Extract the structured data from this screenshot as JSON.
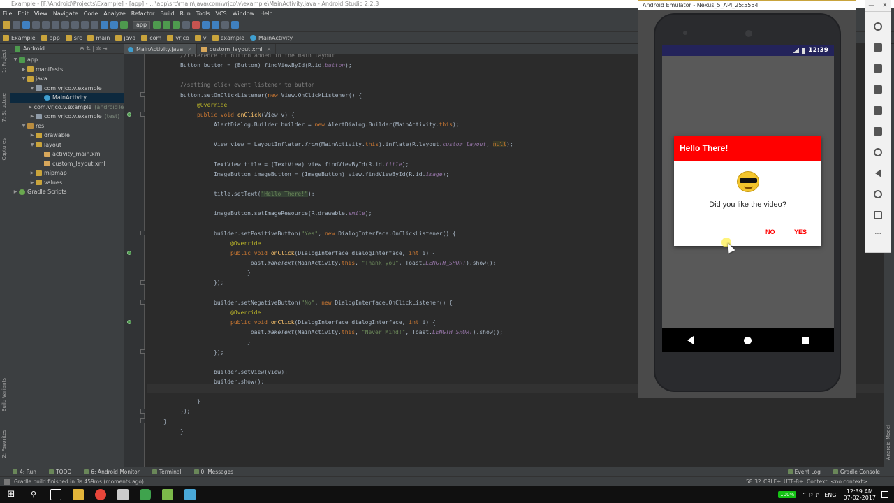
{
  "window_title": "Example - [F:\\Android\\Projects\\Example] - [app] - ...\\app\\src\\main\\java\\com\\vrjco\\v\\example\\MainActivity.java - Android Studio 2.2.3",
  "menu": [
    "File",
    "Edit",
    "View",
    "Navigate",
    "Code",
    "Analyze",
    "Refactor",
    "Build",
    "Run",
    "Tools",
    "VCS",
    "Window",
    "Help"
  ],
  "toolbar": {
    "run_config": "app"
  },
  "breadcrumbs": [
    "Example",
    "app",
    "src",
    "main",
    "java",
    "com",
    "vrjco",
    "v",
    "example",
    "MainActivity"
  ],
  "project_panel": {
    "view_mode": "Android",
    "tree": [
      {
        "label": "app",
        "sub": "",
        "indent": 0,
        "icon": "app",
        "arrow": "▼",
        "sel": false
      },
      {
        "label": "manifests",
        "sub": "",
        "indent": 1,
        "icon": "fold",
        "arrow": "▶",
        "sel": false
      },
      {
        "label": "java",
        "sub": "",
        "indent": 1,
        "icon": "fold",
        "arrow": "▼",
        "sel": false
      },
      {
        "label": "com.vrjco.v.example",
        "sub": "",
        "indent": 2,
        "icon": "pkg",
        "arrow": "▼",
        "sel": false
      },
      {
        "label": "MainActivity",
        "sub": "",
        "indent": 3,
        "icon": "cls",
        "arrow": "",
        "sel": true
      },
      {
        "label": "com.vrjco.v.example",
        "sub": "(androidTest)",
        "indent": 2,
        "icon": "pkg",
        "arrow": "▶",
        "sel": false
      },
      {
        "label": "com.vrjco.v.example",
        "sub": "(test)",
        "indent": 2,
        "icon": "pkg",
        "arrow": "▶",
        "sel": false
      },
      {
        "label": "res",
        "sub": "",
        "indent": 1,
        "icon": "res",
        "arrow": "▼",
        "sel": false
      },
      {
        "label": "drawable",
        "sub": "",
        "indent": 2,
        "icon": "fold",
        "arrow": "▶",
        "sel": false
      },
      {
        "label": "layout",
        "sub": "",
        "indent": 2,
        "icon": "fold",
        "arrow": "▼",
        "sel": false
      },
      {
        "label": "activity_main.xml",
        "sub": "",
        "indent": 3,
        "icon": "xml",
        "arrow": "",
        "sel": false
      },
      {
        "label": "custom_layout.xml",
        "sub": "",
        "indent": 3,
        "icon": "xml",
        "arrow": "",
        "sel": false
      },
      {
        "label": "mipmap",
        "sub": "",
        "indent": 2,
        "icon": "fold",
        "arrow": "▶",
        "sel": false
      },
      {
        "label": "values",
        "sub": "",
        "indent": 2,
        "icon": "fold",
        "arrow": "▶",
        "sel": false
      },
      {
        "label": "Gradle Scripts",
        "sub": "",
        "indent": 0,
        "icon": "grad",
        "arrow": "▶",
        "sel": false
      }
    ]
  },
  "left_tool_windows": [
    "1: Project",
    "7: Structure",
    "Captures",
    "Build Variants",
    "2: Favorites"
  ],
  "right_tool_windows": [
    "Android Model"
  ],
  "editor_tabs": [
    {
      "label": "MainActivity.java",
      "active": true
    },
    {
      "label": "custom_layout.xml",
      "active": false
    }
  ],
  "code_lines": [
    "<span class='com'>//reference of button added in the main layout</span>",
    "<span class='i1'>Button button = (Button) findViewById(R.id.<span class='fld'>button</span>);</span>",
    "",
    "<span class='com'>//setting click event listener to button</span>",
    "button.setOnClickListener(<span class='kw'>new</span> View.OnClickListener() {",
    "    <span class='an'>@Override</span>",
    "    <span class='kw'>public void</span> <span class='meth'>onClick</span>(View v) {",
    "        AlertDialog.Builder builder = <span class='kw'>new</span> AlertDialog.Builder(MainActivity.<span class='kw'>this</span>);",
    "",
    "        View view = LayoutInflater.<span class='st'>from</span>(MainActivity.<span class='kw'>this</span>).inflate(R.layout.<span class='fld'>custom_layout</span>, <span class='nul'>null</span>);",
    "",
    "        TextView title = (TextView) view.findViewById(R.id.<span class='fld'>title</span>);",
    "        ImageButton imageButton = (ImageButton) view.findViewById(R.id.<span class='fld'>image</span>);",
    "",
    "        title.setText(<span class='str hl'>\"Hello There!\"</span>);",
    "",
    "        imageButton.setImageResource(R.drawable.<span class='fld'>smile</span>);",
    "",
    "        builder.setPositiveButton(<span class='str'>\"Yes\"</span>, <span class='kw'>new</span> DialogInterface.OnClickListener() {",
    "            <span class='an'>@Override</span>",
    "            <span class='kw'>public void</span> <span class='meth'>onClick</span>(DialogInterface dialogInterface, <span class='kw'>int</span> i) {",
    "                Toast.<span class='st'>makeText</span>(MainActivity.<span class='kw'>this</span>, <span class='str'>\"Thank you\"</span>, Toast.<span class='fld'>LENGTH_SHORT</span>).show();",
    "            }",
    "        });",
    "",
    "        builder.setNegativeButton(<span class='str'>\"No\"</span>, <span class='kw'>new</span> DialogInterface.OnClickListener() {",
    "            <span class='an'>@Override</span>",
    "            <span class='kw'>public void</span> <span class='meth'>onClick</span>(DialogInterface dialogInterface, <span class='kw'>int</span> i) {",
    "                Toast.<span class='st'>makeText</span>(MainActivity.<span class='kw'>this</span>, <span class='str'>\"Never Mind!\"</span>, Toast.<span class='fld'>LENGTH_SHORT</span>).show();",
    "            }",
    "        });",
    "",
    "        builder.setView(view);",
    "        builder.show();",
    "",
    "    }",
    "});",
    "}",
    "}"
  ],
  "emulator": {
    "title": "Android Emulator - Nexus_5_API_25:5554",
    "time": "12:39",
    "dialog": {
      "title": "Hello There!",
      "message": "Did you like the video?",
      "neg_label": "NO",
      "pos_label": "YES"
    }
  },
  "bottom_tabs": [
    "4: Run",
    "TODO",
    "6: Android Monitor",
    "Terminal",
    "0: Messages",
    "Event Log",
    "Gradle Console"
  ],
  "status": {
    "message": "Gradle build finished in 3s 459ms (moments ago)",
    "position": "58:32",
    "line_sep": "CRLF÷",
    "encoding": "UTF-8÷",
    "context": "Context: <no context>"
  },
  "taskbar": {
    "battery": "100%",
    "lang": "ENG",
    "time": "12:39 AM",
    "date": "07-02-2017"
  }
}
